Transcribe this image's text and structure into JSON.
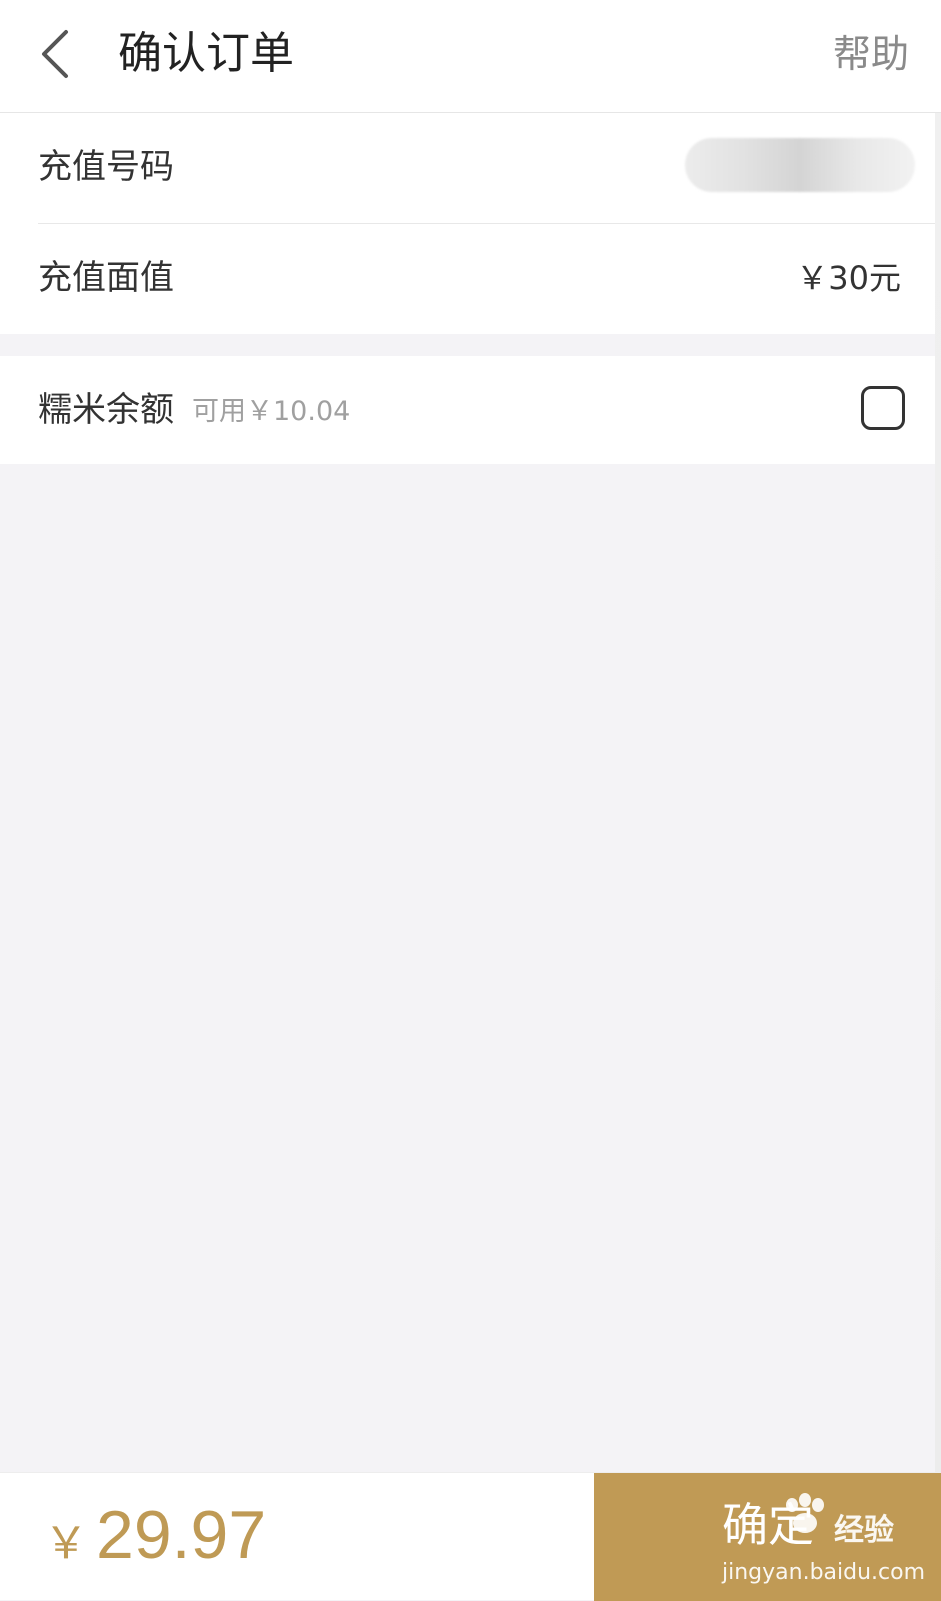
{
  "header": {
    "title": "确认订单",
    "help_label": "帮助"
  },
  "order": {
    "phone_label": "充值号码",
    "face_value_label": "充值面值",
    "face_value": "￥30元"
  },
  "balance": {
    "label": "糯米余额",
    "available": "可用￥10.04",
    "checked": false
  },
  "footer": {
    "currency": "￥",
    "total": "29.97",
    "confirm_label": "确定",
    "watermark_text": "经验",
    "watermark_url": "jingyan.baidu.com"
  },
  "colors": {
    "accent": "#c09a55",
    "background": "#f4f3f6"
  }
}
